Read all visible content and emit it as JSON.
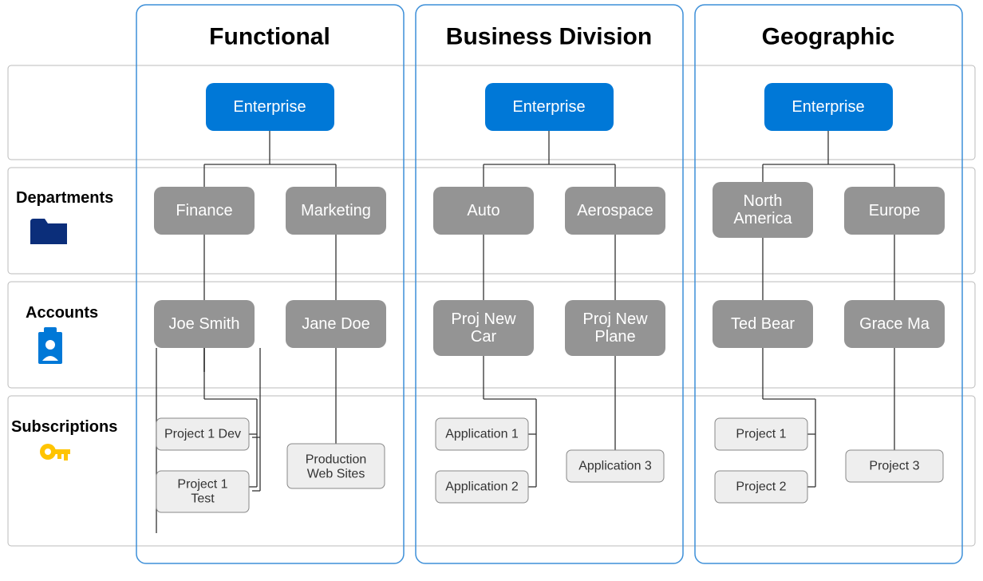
{
  "columns": [
    {
      "title": "Functional"
    },
    {
      "title": "Business Division"
    },
    {
      "title": "Geographic"
    }
  ],
  "rows": [
    {
      "label": "Departments"
    },
    {
      "label": "Accounts"
    },
    {
      "label": "Subscriptions"
    }
  ],
  "enterprise_label": "Enterprise",
  "trees": {
    "functional": {
      "departments": [
        "Finance",
        "Marketing"
      ],
      "accounts": [
        "Joe Smith",
        "Jane Doe"
      ],
      "subscriptions": [
        [
          "Project 1 Dev",
          "Project 1 Test"
        ],
        [
          "Production Web Sites"
        ]
      ]
    },
    "business": {
      "departments": [
        "Auto",
        "Aerospace"
      ],
      "accounts": [
        "Proj New Car",
        "Proj New Plane"
      ],
      "subscriptions": [
        [
          "Application 1",
          "Application 2"
        ],
        [
          "Application 3"
        ]
      ]
    },
    "geographic": {
      "departments": [
        "North America",
        "Europe"
      ],
      "accounts": [
        "Ted Bear",
        "Grace Ma"
      ],
      "subscriptions": [
        [
          "Project 1",
          "Project 2"
        ],
        [
          "Project 3"
        ]
      ]
    }
  },
  "colors": {
    "enterprise": "#0078d7",
    "department": "#949494",
    "account": "#949494",
    "subscription": "#eeeeee",
    "column_border": "#3d8fd8",
    "folder_icon": "#0b2e7a",
    "badge_icon": "#0078d7",
    "key_icon": "#ffc400"
  }
}
